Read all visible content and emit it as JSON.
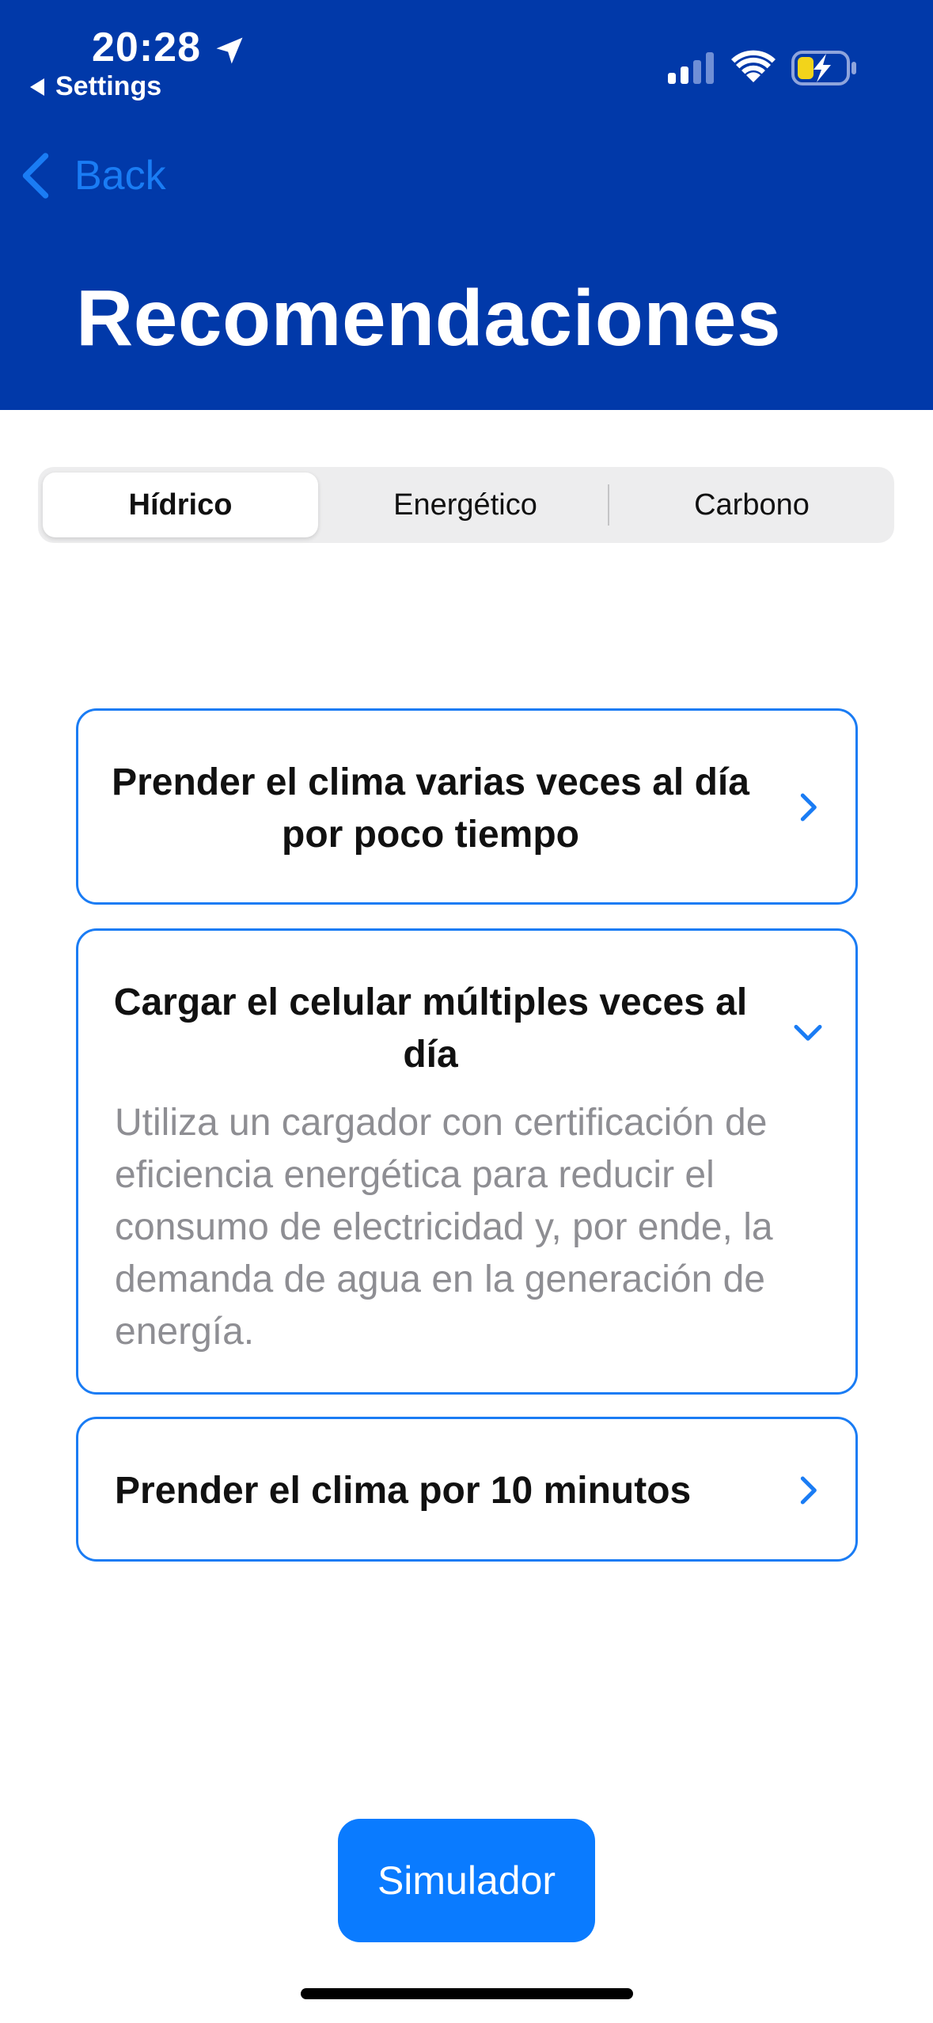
{
  "status_bar": {
    "time": "20:28",
    "back_app": "Settings",
    "icons": [
      "location-arrow-icon",
      "cellular-signal-icon",
      "wifi-icon",
      "battery-charging-icon"
    ]
  },
  "nav": {
    "back_label": "Back",
    "title": "Recomendaciones"
  },
  "tabs": [
    {
      "label": "Hídrico",
      "selected": true
    },
    {
      "label": "Energético",
      "selected": false
    },
    {
      "label": "Carbono",
      "selected": false
    }
  ],
  "recommendations": [
    {
      "title": "Prender el clima varias veces al día por poco tiempo",
      "expanded": false,
      "chevron": "chevron-right-icon"
    },
    {
      "title": "Cargar el celular múltiples veces al día",
      "expanded": true,
      "chevron": "chevron-down-icon",
      "detail": "Utiliza un cargador con certificación de eficiencia energética para reducir el consumo de electricidad y, por ende, la demanda de agua en la generación de energía."
    },
    {
      "title": "Prender el clima por 10 minutos",
      "expanded": false,
      "chevron": "chevron-right-icon"
    }
  ],
  "simulator_button": "Simulador",
  "colors": {
    "header_bg": "#0139a9",
    "accent": "#1a7cf4",
    "button_bg": "#0a7bff",
    "detail_text": "#8e8e93"
  }
}
